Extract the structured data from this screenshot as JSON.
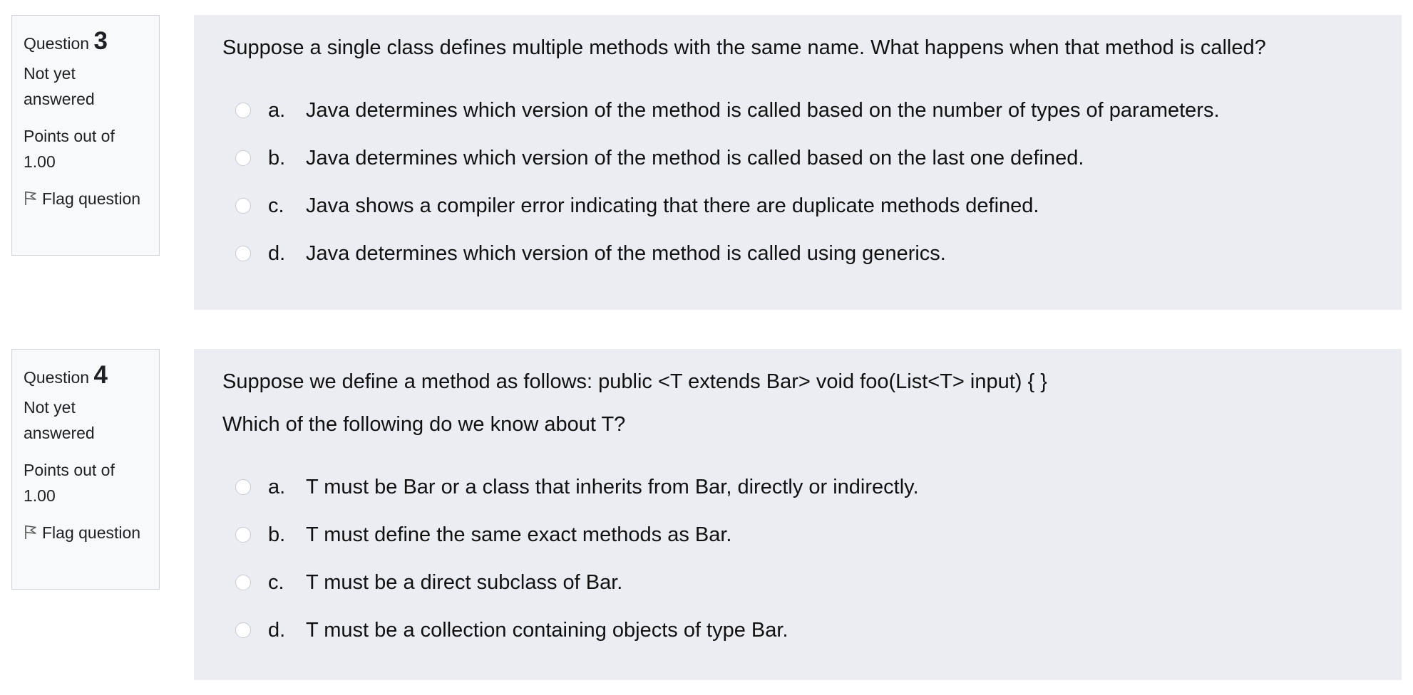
{
  "questions": [
    {
      "label": "Question",
      "number": "3",
      "state": "Not yet answered",
      "grade": "Points out of 1.00",
      "flag_label": "Flag question",
      "text": [
        "Suppose a single class defines multiple methods with the same name. What happens when that method is called?"
      ],
      "answers": [
        {
          "letter": "a.",
          "text": "Java determines which version of the method is called based on the number of types of parameters."
        },
        {
          "letter": "b.",
          "text": "Java determines which version of the method is called based on the last one defined."
        },
        {
          "letter": "c.",
          "text": "Java shows a compiler error indicating that there are duplicate methods defined."
        },
        {
          "letter": "d.",
          "text": "Java determines which version of the method is called using generics."
        }
      ]
    },
    {
      "label": "Question",
      "number": "4",
      "state": "Not yet answered",
      "grade": "Points out of 1.00",
      "flag_label": "Flag question",
      "text": [
        "Suppose we define a method as follows: public <T extends Bar> void foo(List<T> input) { }",
        "Which of the following do we know about T?"
      ],
      "answers": [
        {
          "letter": "a.",
          "text": "T must be Bar or a class that inherits from Bar, directly or indirectly."
        },
        {
          "letter": "b.",
          "text": "T must define the same exact methods as Bar."
        },
        {
          "letter": "c.",
          "text": "T must be a direct subclass of Bar."
        },
        {
          "letter": "d.",
          "text": "T must be a collection containing objects of type Bar."
        }
      ]
    }
  ],
  "icons": {
    "flag": "flag-icon",
    "radio": "radio-unchecked-icon"
  },
  "colors": {
    "info_background": "#f8f9fa",
    "content_background": "#ecedf2",
    "border": "#cfd2d6"
  }
}
